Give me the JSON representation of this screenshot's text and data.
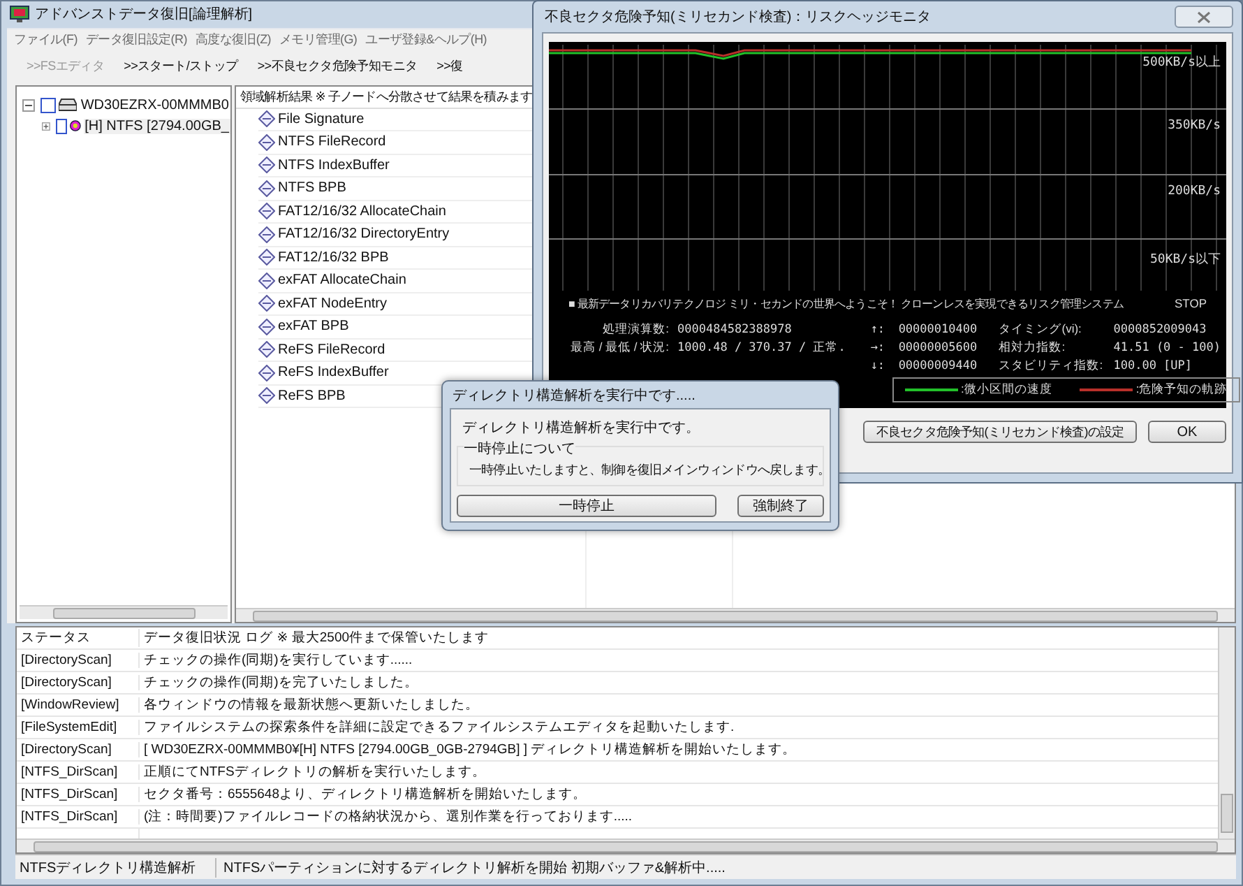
{
  "window": {
    "title": "アドバンストデータ復旧[論理解析]"
  },
  "menu": [
    "ファイル(F)",
    "データ復旧設定(R)",
    "高度な復旧(Z)",
    "メモリ管理(G)",
    "ユーザ登録&ヘルプ(H)"
  ],
  "toolbar": [
    {
      "label": ">>FSエディタ",
      "disabled": true
    },
    {
      "label": ">>スタート/ストップ",
      "disabled": false
    },
    {
      "label": ">>不良セクタ危険予知モニタ",
      "disabled": false
    },
    {
      "label": ">>復",
      "disabled": false
    }
  ],
  "tree": [
    {
      "label": "WD30EZRX-00MMMB0",
      "kind": "drive",
      "checked": false,
      "expanded": true,
      "children": [
        {
          "label": "[H] NTFS [2794.00GB_",
          "kind": "partition",
          "checked": false,
          "expanded": false
        }
      ]
    }
  ],
  "analysis": {
    "header": "領域解析結果 ※ 子ノードへ分散させて結果を積みます",
    "items": [
      "File Signature",
      "NTFS FileRecord",
      "NTFS IndexBuffer",
      "NTFS BPB",
      "FAT12/16/32 AllocateChain",
      "FAT12/16/32 DirectoryEntry",
      "FAT12/16/32 BPB",
      "exFAT AllocateChain",
      "exFAT NodeEntry",
      "exFAT BPB",
      "ReFS FileRecord",
      "ReFS IndexBuffer",
      "ReFS BPB"
    ]
  },
  "log": {
    "columns": [
      "ステータス",
      "データ復旧状況 ログ ※ 最大2500件まで保管いたします"
    ],
    "rows": [
      [
        "[DirectoryScan]",
        "チェックの操作(同期)を実行しています......"
      ],
      [
        "[DirectoryScan]",
        "チェックの操作(同期)を完了いたしました。"
      ],
      [
        "[WindowReview]",
        "各ウィンドウの情報を最新状態へ更新いたしました。"
      ],
      [
        "[FileSystemEdit]",
        "ファイルシステムの探索条件を詳細に設定できるファイルシステムエディタを起動いたします."
      ],
      [
        "[DirectoryScan]",
        "[ WD30EZRX-00MMMB0¥[H] NTFS [2794.00GB_0GB-2794GB] ] ディレクトリ構造解析を開始いたします。"
      ],
      [
        "[NTFS_DirScan]",
        "正順にてNTFSディレクトリの解析を実行いたします。"
      ],
      [
        "[NTFS_DirScan]",
        "セクタ番号：6555648より、ディレクトリ構造解析を開始いたします。"
      ],
      [
        "[NTFS_DirScan]",
        "(注：時間要)ファイルレコードの格納状況から、選別作業を行っております....."
      ]
    ]
  },
  "status_bar": [
    "NTFSディレクトリ構造解析",
    "NTFSパーティションに対するディレクトリ解析を開始 初期バッファ&解析中....."
  ],
  "monitor": {
    "title": "不良セクタ危険予知(ミリセカンド検査)：リスクヘッジモニタ",
    "graph_labels": [
      "500KB/s以上",
      "350KB/s",
      "200KB/s",
      "50KB/s以下"
    ],
    "banner": "■ 最新データリカバリテクノロジ ミリ・セカンドの世界へようこそ！ クローンレスを実現できるリスク管理システム",
    "state": "STOP",
    "stats": [
      {
        "label": "処理演算数:",
        "value": "0000484582388978"
      },
      {
        "label": "最高 / 最低 / 状況:",
        "value": "1000.48 / 370.37 / 正常."
      }
    ],
    "arrows": [
      {
        "label": "↑:",
        "value": "00000010400"
      },
      {
        "label": "→:",
        "value": "00000005600"
      },
      {
        "label": "↓:",
        "value": "00000009440"
      }
    ],
    "indices": [
      {
        "label": "タイミング(vi):",
        "value": "0000852009043"
      },
      {
        "label": "相対力指数:",
        "value": "41.51 (0 - 100)"
      },
      {
        "label": "スタビリティ指数:",
        "value": "100.00 [UP]"
      }
    ],
    "legend": [
      {
        "label": ":微小区間の速度",
        "color": "#22c02a"
      },
      {
        "label": ":危険予知の軌跡",
        "color": "#b8302a"
      }
    ],
    "buttons": [
      "不良セクタ危険予知(ミリセカンド検査)の設定",
      "OK"
    ]
  },
  "dialog": {
    "title": "ディレクトリ構造解析を実行中です.....",
    "message": "ディレクトリ構造解析を実行中です。",
    "group_title": "一時停止について",
    "group_text": "一時停止いたしますと、制御を復旧メインウィンドウへ戻します。",
    "buttons": [
      "一時停止",
      "強制終了"
    ]
  }
}
